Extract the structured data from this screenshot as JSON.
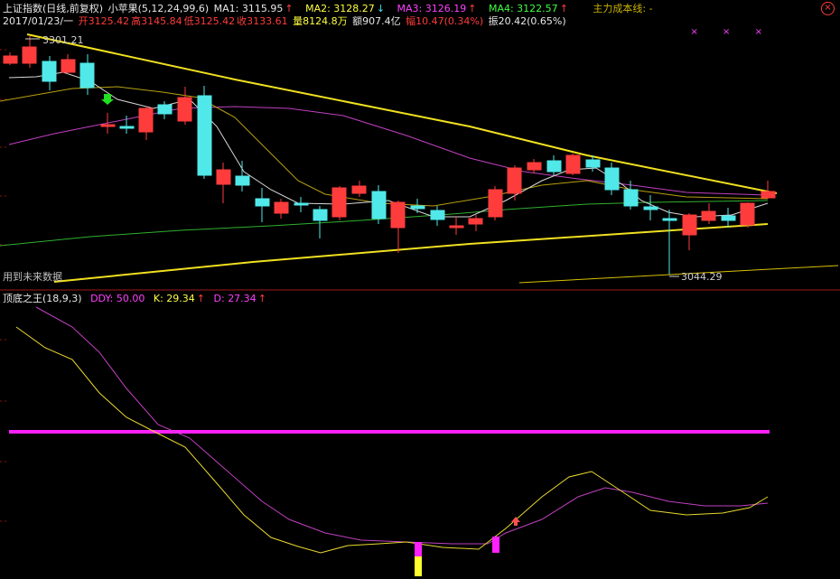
{
  "header": {
    "index_name": "上证指数(日线,前复权)",
    "indicator_name": "小苹果(5,12,24,99,6)",
    "ma1_label": "MA1: 3115.95",
    "ma1_arrow": "↑",
    "ma2_label": "MA2: 3128.27",
    "ma2_arrow": "↓",
    "ma3_label": "MA3: 3126.19",
    "ma3_arrow": "↑",
    "ma4_label": "MA4: 3122.57",
    "ma4_arrow": "↑",
    "cost_line_label": "主力成本线: -",
    "close_symbol": "×"
  },
  "quote": {
    "date": "2017/01/23/一",
    "open": "开3125.42",
    "high": "高3145.84",
    "low": "低3125.42",
    "close": "收3133.61",
    "volume": "量8124.8万",
    "amount": "额907.4亿",
    "change": "幅10.47(0.34%)",
    "amplitude": "振20.42(0.65%)"
  },
  "markers": "× × ×",
  "price_labels": {
    "high": "3301.21",
    "low": "3044.29"
  },
  "future_note": "用到未来数据",
  "sub_header": {
    "name": "顶底之王(18,9,3)",
    "ddy": "DDY: 50.00",
    "k": "K: 29.34",
    "k_arrow": "↑",
    "d": "D: 27.34",
    "d_arrow": "↑"
  },
  "colors": {
    "up": "#ff3c3c",
    "down": "#50e8e8",
    "ma_white": "#e0e0e0",
    "ma_yellow": "#c8b400",
    "ma_magenta": "#c040c0",
    "ma_green": "#30b030",
    "trend": "#ffff30",
    "ddy_line": "#ff20ff"
  }
}
